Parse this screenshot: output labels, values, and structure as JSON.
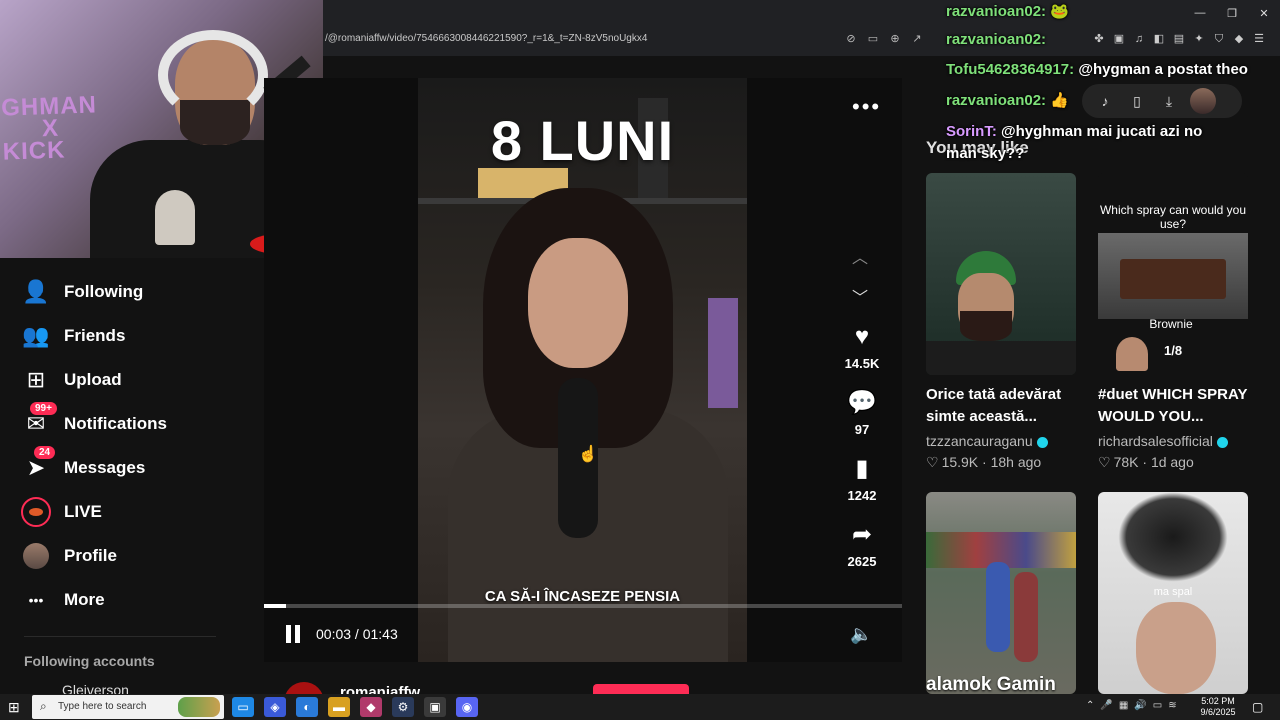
{
  "browser": {
    "url": "/@romaniaffw/video/7546663008446221590?_r=1&_t=ZN-8zV5noUgkx4",
    "window_controls": [
      "—",
      "❐",
      "✕"
    ]
  },
  "webcam": {
    "wall_text_line1": "GHMAN",
    "wall_text_line2": "X",
    "wall_text_line3": "KICK"
  },
  "chat": [
    {
      "user": "razvanioan02:",
      "message": "🐸"
    },
    {
      "user": "razvanioan02:",
      "message": ""
    },
    {
      "user": "Tofu54628364917:",
      "message": "@hygman a postat theo"
    },
    {
      "user": "razvanioan02:",
      "message": "👍"
    },
    {
      "user": "SorinT:",
      "message": "@hyghman mai jucati azi no"
    },
    {
      "user": "",
      "message": "man sky??"
    }
  ],
  "sidebar": {
    "items": [
      {
        "label": "Following",
        "icon": "following-icon",
        "glyph": "👤"
      },
      {
        "label": "Friends",
        "icon": "friends-icon",
        "glyph": "👥"
      },
      {
        "label": "Upload",
        "icon": "upload-icon",
        "glyph": "⊞"
      },
      {
        "label": "Notifications",
        "icon": "notifications-icon",
        "glyph": "✉",
        "badge": "99+"
      },
      {
        "label": "Messages",
        "icon": "messages-icon",
        "glyph": "➤",
        "badge": "24"
      },
      {
        "label": "LIVE",
        "icon": "live-icon"
      },
      {
        "label": "Profile",
        "icon": "profile-icon"
      },
      {
        "label": "More",
        "icon": "more-icon",
        "glyph": "•••"
      }
    ],
    "following_accounts": "Following accounts",
    "first_account": "Gleiverson"
  },
  "video": {
    "title": "8 LUNI",
    "subtitle": "CA SĂ-I ÎNCASEZE PENSIA",
    "time": "00:03 / 01:43",
    "progress_fraction": 0.035,
    "author": "romaniaffw"
  },
  "actions": {
    "likes": "14.5K",
    "comments": "97",
    "saves": "1242",
    "shares": "2625"
  },
  "recommend": {
    "heading": "You may like",
    "cards": [
      {
        "title": "Orice tată adevărat simte această...",
        "author": "tzzzancauraganu",
        "likes": "15.9K",
        "age": "18h ago"
      },
      {
        "title": "#duet WHICH SPRAY WOULD YOU...",
        "author": "richardsalesofficial",
        "likes": "78K",
        "age": "1d ago",
        "overlay_question": "Which spray can would you use?",
        "overlay_label": "Brownie",
        "overlay_count": "1/8"
      },
      {
        "overlay_text": "alamok Gamin"
      },
      {
        "overlay_text": "ma spal"
      }
    ]
  },
  "taskbar": {
    "search_placeholder": "Type here to search",
    "time": "5:02 PM",
    "date": "9/6/2025"
  },
  "colors": {
    "accent": "#fe2c55",
    "verified": "#20d5ec",
    "chat_user": "#7fe07a"
  }
}
